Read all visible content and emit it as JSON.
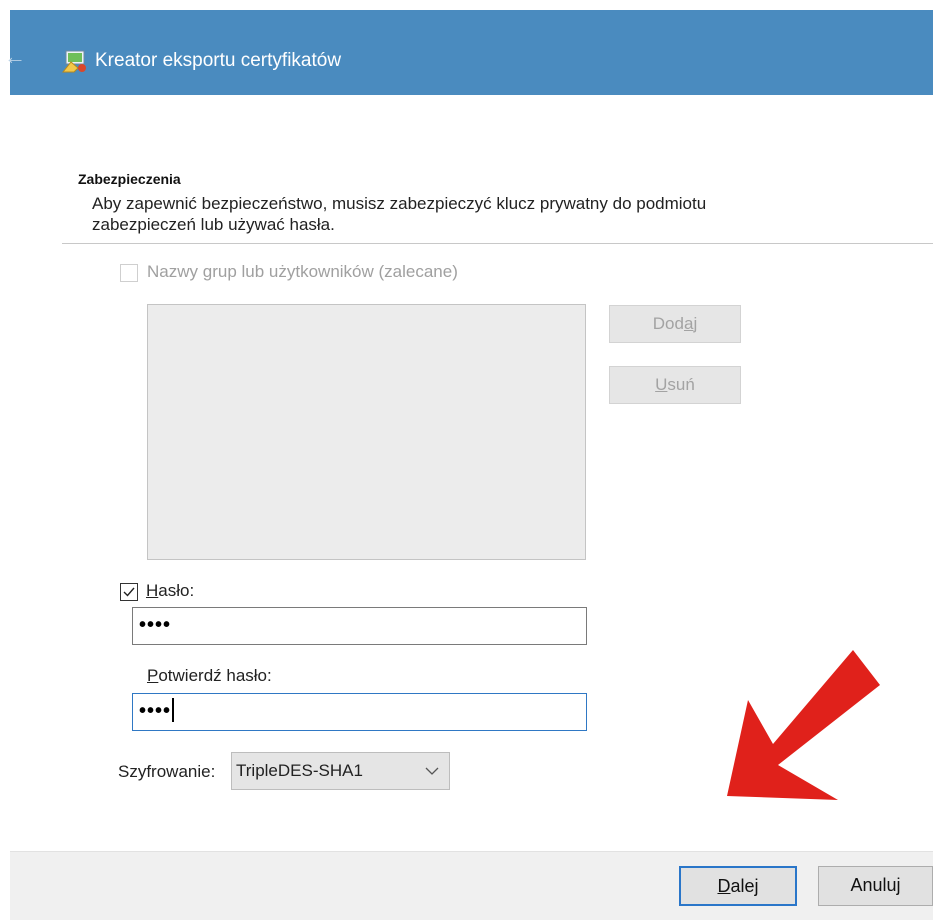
{
  "window": {
    "title": "Kreator eksportu certyfikatów",
    "back_icon": "back-arrow-icon",
    "app_icon": "certificate-wizard-icon",
    "titlebar_color": "#4a8bbf"
  },
  "section": {
    "heading": "Zabezpieczenia",
    "description_line1": "Aby zapewnić bezpieczeństwo, musisz zabezpieczyć klucz prywatny do podmiotu",
    "description_line2": "zabezpieczeń lub używać hasła."
  },
  "groups": {
    "checked": false,
    "enabled": false,
    "label_pre": "Nazwy ",
    "label_mnemonic": "g",
    "label_post": "rup lub użytkowników (zalecane)",
    "add_pre": "Dod",
    "add_mnemonic": "a",
    "add_post": "j",
    "remove_pre": "",
    "remove_mnemonic": "U",
    "remove_post": "suń"
  },
  "password": {
    "checked": true,
    "label_mnemonic": "H",
    "label_post": "asło:",
    "value_masked": "••••",
    "confirm_mnemonic": "P",
    "confirm_post": "otwierdź hasło:",
    "confirm_value_masked": "••••"
  },
  "encryption": {
    "label": "Szyfrowanie:",
    "selected": "TripleDES-SHA1",
    "chevron_icon": "chevron-down-icon"
  },
  "footer": {
    "next_mnemonic": "D",
    "next_post": "alej",
    "cancel": "Anuluj"
  },
  "annotation": {
    "arrow_icon": "red-arrow-annotation",
    "arrow_color": "#e0211b",
    "focus_color": "#2f78c4"
  }
}
